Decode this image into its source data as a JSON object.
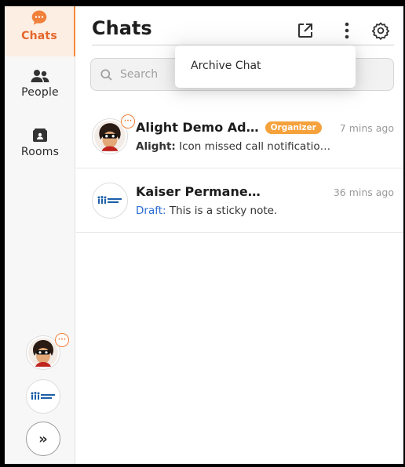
{
  "sidebar": {
    "items": [
      {
        "label": "Chats",
        "icon": "chat-bubble-icon",
        "active": true
      },
      {
        "label": "People",
        "icon": "people-icon",
        "active": false
      },
      {
        "label": "Rooms",
        "icon": "rooms-icon",
        "active": false
      }
    ],
    "accent": "#f28a3e",
    "expand_label": "»"
  },
  "header": {
    "title": "Chats",
    "icons": [
      "open-external-icon",
      "more-vertical-icon",
      "settings-gear-icon"
    ]
  },
  "search": {
    "placeholder": "Search"
  },
  "menu": {
    "items": [
      "Archive Chat"
    ]
  },
  "chats": [
    {
      "name": "Alight Demo Ad…",
      "badge": "Organizer",
      "time": "7 mins ago",
      "sender": "Alight:",
      "message": "Icon missed call notificatio…",
      "unread_badge": "···"
    },
    {
      "name": "Kaiser Permane…",
      "time": "36 mins ago",
      "draft_label": "Draft:",
      "message": "This is a sticky note."
    }
  ],
  "rail_avatars": [
    {
      "name": "Alight Demo avatar",
      "unread_badge": "···"
    },
    {
      "name": "Kaiser Permanente logo",
      "logo_text": "KAISER PERMANENTE"
    }
  ],
  "colors": {
    "badge": "#f5a13c",
    "draft": "#2d6ed5",
    "active_bg": "#fdeee3"
  }
}
